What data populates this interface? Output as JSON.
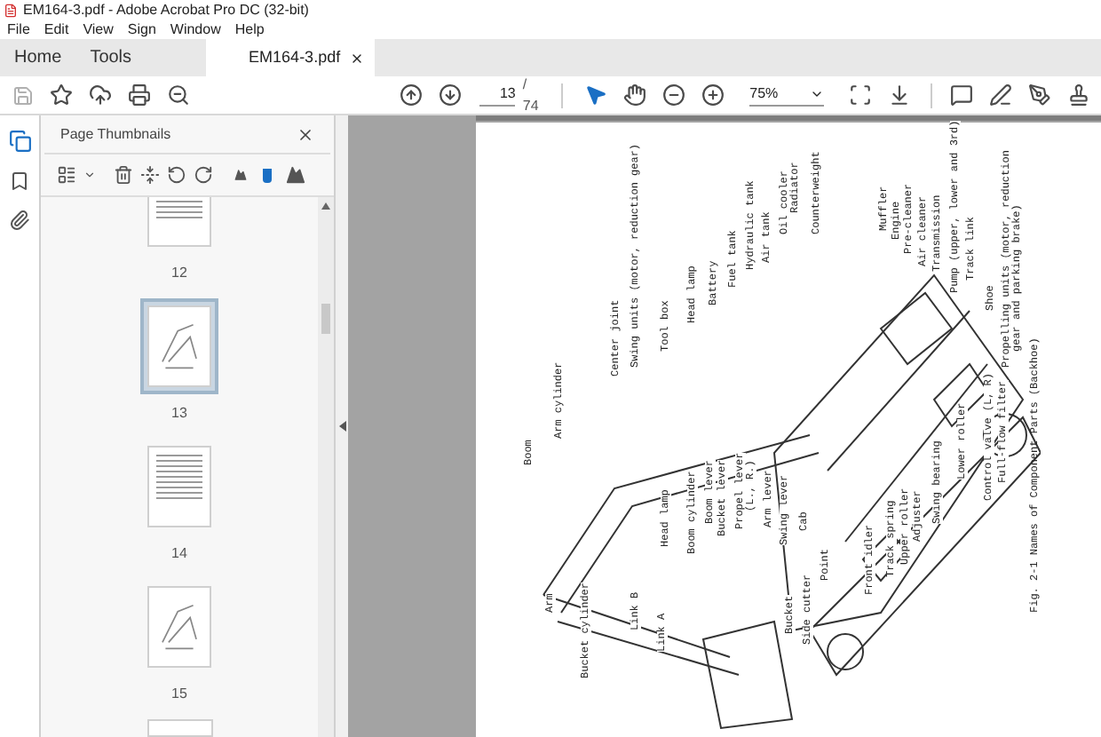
{
  "window": {
    "title": "EM164-3.pdf - Adobe Acrobat Pro DC (32-bit)"
  },
  "menu": [
    "File",
    "Edit",
    "View",
    "Sign",
    "Window",
    "Help"
  ],
  "tabs": [
    {
      "label": "Home",
      "selected": false
    },
    {
      "label": "Tools",
      "selected": false
    },
    {
      "label": "EM164-3.pdf",
      "selected": true
    }
  ],
  "toolbar": {
    "page": "13",
    "page_count": "/ 74",
    "zoom": "75%"
  },
  "thumbnails_panel": {
    "title": "Page Thumbnails",
    "thumbnail_size": {
      "level": 0.5
    },
    "pages": [
      {
        "label": "12",
        "kind": "text",
        "selected": false
      },
      {
        "label": "13",
        "kind": "figure",
        "selected": true
      },
      {
        "label": "14",
        "kind": "text",
        "selected": false
      },
      {
        "label": "15",
        "kind": "figure",
        "selected": false
      }
    ]
  },
  "document": {
    "labels": [
      "Boom",
      "Arm cylinder",
      "Arm",
      "Bucket cylinder",
      "Center joint",
      "Link B",
      "Swing units (motor, reduction gear)",
      "Link A",
      "Tool box",
      "Head lamp",
      "Head lamp",
      "Boom cylinder",
      "Battery",
      "Boom lever",
      "Bucket lever",
      "Fuel tank",
      "Propel lever",
      "(L., R.)",
      "Hydraulic tank",
      "Air tank",
      "Arm lever",
      "Swing lever",
      "Oil cooler",
      "Bucket",
      "Radiator",
      "Side cutter",
      "Cab",
      "Counterweight",
      "Point",
      "Muffler",
      "Engine",
      "Pre-cleaner",
      "Front idler",
      "Air cleaner",
      "Track spring",
      "Transmission",
      "Upper roller",
      "Pump (upper, lower and 3rd)",
      "Adjuster",
      "Track link",
      "Swing bearing",
      "Shoe",
      "Lower roller",
      "Control valve (L, R)",
      "Propelling units (motor, reduction",
      "Full-flow filter",
      "gear and parking brake)"
    ],
    "caption": "Fig. 2-1  Names of Component Parts (Backhoe)"
  }
}
